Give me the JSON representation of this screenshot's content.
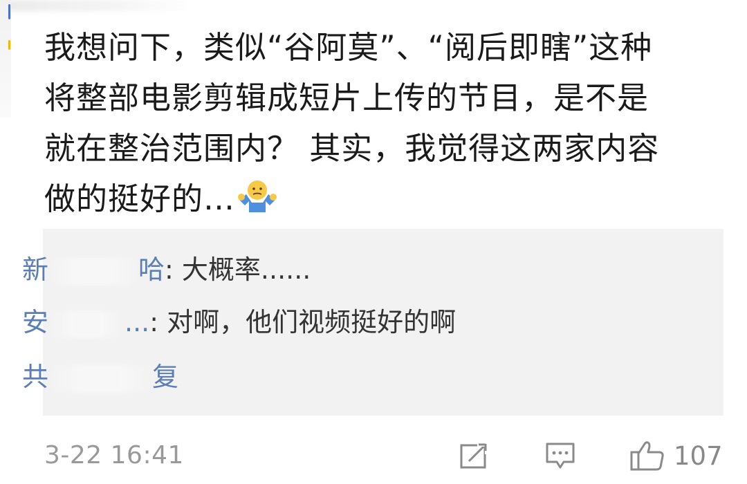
{
  "comment": {
    "lines": [
      "我想问下，类似“谷阿莫”、“阅后即瞎”这种",
      "将整部电影剪辑成短片上传的节目，是不是",
      "就在整治范围内？ 其实，我觉得这两家内容",
      "做的挺好的…"
    ],
    "emoji": "shrug-emoji"
  },
  "replies": [
    {
      "name_prefix": "新",
      "name_suffix": "哈",
      "text": ": 大概率......"
    },
    {
      "name_prefix": "安",
      "name_suffix": "...",
      "text": ": 对啊，他们视频挺好的啊"
    },
    {
      "summary_prefix": "共",
      "summary_suffix": "复"
    }
  ],
  "footer": {
    "timestamp": "3-22 16:41",
    "share_icon": "share-icon",
    "comment_icon": "comment-icon",
    "like_icon": "thumbs-up-icon",
    "like_count": "107"
  },
  "colors": {
    "text": "#1a1a1a",
    "reply_name": "#5b7fb4",
    "reply_bg": "#f2f2f2",
    "meta": "#999999"
  }
}
